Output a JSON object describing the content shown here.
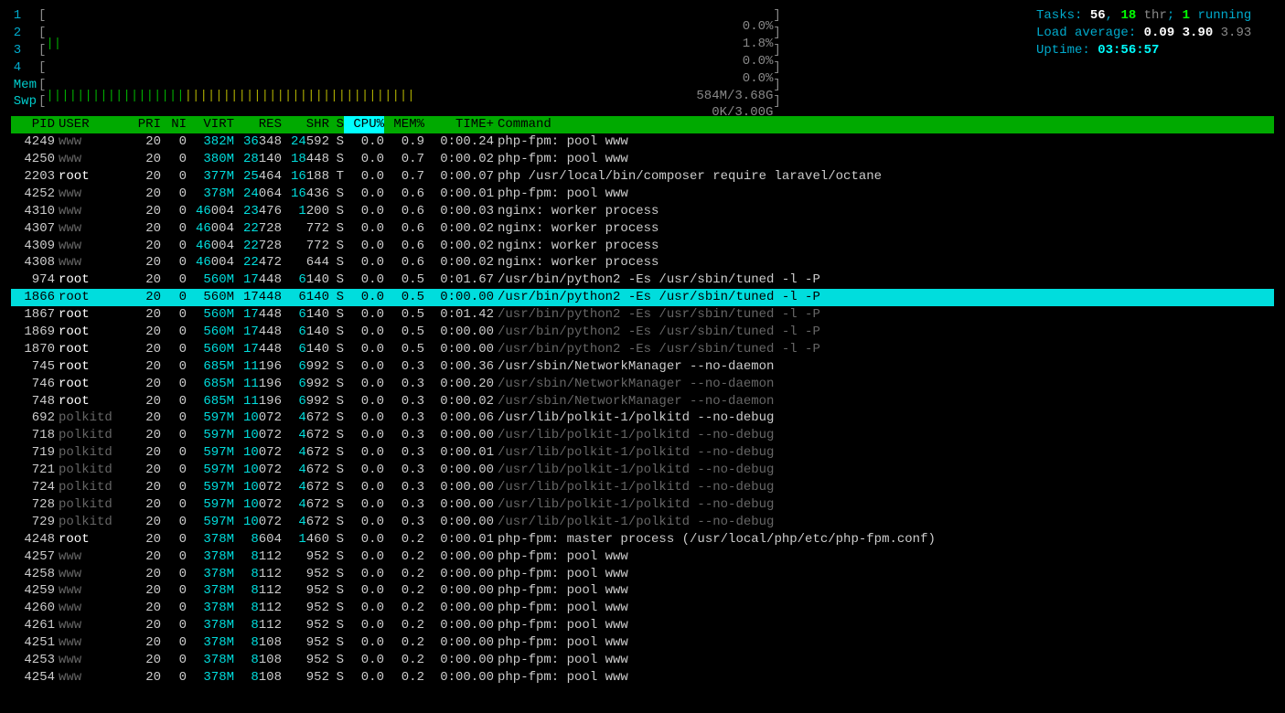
{
  "meters": {
    "cpus": [
      {
        "label": "1",
        "bar": "",
        "pct": "0.0%"
      },
      {
        "label": "2",
        "bar": "||",
        "pct": "1.8%"
      },
      {
        "label": "3",
        "bar": "",
        "pct": "0.0%"
      },
      {
        "label": "4",
        "bar": "",
        "pct": "0.0%"
      }
    ],
    "mem": {
      "label": "Mem",
      "bar_green": "||||||||||||||||||",
      "bar_yellow": "||||||||||||||||||||||||||||||",
      "pct": "584M/3.68G"
    },
    "swp": {
      "label": "Swp",
      "bar": "",
      "pct": "0K/3.00G"
    }
  },
  "stats": {
    "tasks_label": "Tasks: ",
    "tasks_total": "56",
    "tasks_sep": ", ",
    "tasks_thr": "18",
    "tasks_thr_label": " thr",
    "tasks_sep2": "; ",
    "tasks_running": "1",
    "tasks_running_label": " running",
    "load_label": "Load average: ",
    "load1": "0.09",
    "load5": "3.90",
    "load15": "3.93",
    "uptime_label": "Uptime: ",
    "uptime": "03:56:57"
  },
  "headers": {
    "pid": "PID",
    "user": "USER",
    "pri": "PRI",
    "ni": "NI",
    "virt": "VIRT",
    "res": "RES",
    "shr": "SHR",
    "s": "S",
    "cpu": "CPU%",
    "mem": "MEM%",
    "time": "TIME+",
    "cmd": "Command"
  },
  "processes": [
    {
      "pid": "4249",
      "user": "www",
      "udim": true,
      "pri": "20",
      "ni": "0",
      "virt": "382M",
      "res": "36348",
      "resc": 2,
      "shr": "24592",
      "shrc": 2,
      "s": "S",
      "cpu": "0.0",
      "mem": "0.9",
      "time": "0:00.24",
      "cmd": "php-fpm: pool www",
      "cdim": false
    },
    {
      "pid": "4250",
      "user": "www",
      "udim": true,
      "pri": "20",
      "ni": "0",
      "virt": "380M",
      "res": "28140",
      "resc": 2,
      "shr": "18448",
      "shrc": 2,
      "s": "S",
      "cpu": "0.0",
      "mem": "0.7",
      "time": "0:00.02",
      "cmd": "php-fpm: pool www",
      "cdim": false
    },
    {
      "pid": "2203",
      "user": "root",
      "udim": false,
      "pri": "20",
      "ni": "0",
      "virt": "377M",
      "res": "25464",
      "resc": 2,
      "shr": "16188",
      "shrc": 2,
      "s": "T",
      "cpu": "0.0",
      "mem": "0.7",
      "time": "0:00.07",
      "cmd": "php /usr/local/bin/composer require laravel/octane",
      "cdim": false
    },
    {
      "pid": "4252",
      "user": "www",
      "udim": true,
      "pri": "20",
      "ni": "0",
      "virt": "378M",
      "res": "24064",
      "resc": 2,
      "shr": "16436",
      "shrc": 2,
      "s": "S",
      "cpu": "0.0",
      "mem": "0.6",
      "time": "0:00.01",
      "cmd": "php-fpm: pool www",
      "cdim": false
    },
    {
      "pid": "4310",
      "user": "www",
      "udim": true,
      "pri": "20",
      "ni": "0",
      "virt": "46004",
      "res": "23476",
      "resc": 2,
      "shr": "1200",
      "shrc": 1,
      "s": "S",
      "cpu": "0.0",
      "mem": "0.6",
      "time": "0:00.03",
      "cmd": "nginx: worker process",
      "cdim": false
    },
    {
      "pid": "4307",
      "user": "www",
      "udim": true,
      "pri": "20",
      "ni": "0",
      "virt": "46004",
      "res": "22728",
      "resc": 2,
      "shr": "772",
      "shrc": 0,
      "s": "S",
      "cpu": "0.0",
      "mem": "0.6",
      "time": "0:00.02",
      "cmd": "nginx: worker process",
      "cdim": false
    },
    {
      "pid": "4309",
      "user": "www",
      "udim": true,
      "pri": "20",
      "ni": "0",
      "virt": "46004",
      "res": "22728",
      "resc": 2,
      "shr": "772",
      "shrc": 0,
      "s": "S",
      "cpu": "0.0",
      "mem": "0.6",
      "time": "0:00.02",
      "cmd": "nginx: worker process",
      "cdim": false
    },
    {
      "pid": "4308",
      "user": "www",
      "udim": true,
      "pri": "20",
      "ni": "0",
      "virt": "46004",
      "res": "22472",
      "resc": 2,
      "shr": "644",
      "shrc": 0,
      "s": "S",
      "cpu": "0.0",
      "mem": "0.6",
      "time": "0:00.02",
      "cmd": "nginx: worker process",
      "cdim": false
    },
    {
      "pid": "974",
      "user": "root",
      "udim": false,
      "pri": "20",
      "ni": "0",
      "virt": "560M",
      "res": "17448",
      "resc": 2,
      "shr": "6140",
      "shrc": 1,
      "s": "S",
      "cpu": "0.0",
      "mem": "0.5",
      "time": "0:01.67",
      "cmd": "/usr/bin/python2 -Es /usr/sbin/tuned -l -P",
      "cdim": false
    },
    {
      "pid": "1866",
      "user": "root",
      "udim": false,
      "pri": "20",
      "ni": "0",
      "virt": "560M",
      "res": "17448",
      "resc": 2,
      "shr": "6140",
      "shrc": 1,
      "s": "S",
      "cpu": "0.0",
      "mem": "0.5",
      "time": "0:00.00",
      "cmd": "/usr/bin/python2 -Es /usr/sbin/tuned -l -P",
      "cdim": false,
      "sel": true
    },
    {
      "pid": "1867",
      "user": "root",
      "udim": false,
      "pri": "20",
      "ni": "0",
      "virt": "560M",
      "res": "17448",
      "resc": 2,
      "shr": "6140",
      "shrc": 1,
      "s": "S",
      "cpu": "0.0",
      "mem": "0.5",
      "time": "0:01.42",
      "cmd": "/usr/bin/python2 -Es /usr/sbin/tuned -l -P",
      "cdim": true
    },
    {
      "pid": "1869",
      "user": "root",
      "udim": false,
      "pri": "20",
      "ni": "0",
      "virt": "560M",
      "res": "17448",
      "resc": 2,
      "shr": "6140",
      "shrc": 1,
      "s": "S",
      "cpu": "0.0",
      "mem": "0.5",
      "time": "0:00.00",
      "cmd": "/usr/bin/python2 -Es /usr/sbin/tuned -l -P",
      "cdim": true
    },
    {
      "pid": "1870",
      "user": "root",
      "udim": false,
      "pri": "20",
      "ni": "0",
      "virt": "560M",
      "res": "17448",
      "resc": 2,
      "shr": "6140",
      "shrc": 1,
      "s": "S",
      "cpu": "0.0",
      "mem": "0.5",
      "time": "0:00.00",
      "cmd": "/usr/bin/python2 -Es /usr/sbin/tuned -l -P",
      "cdim": true
    },
    {
      "pid": "745",
      "user": "root",
      "udim": false,
      "pri": "20",
      "ni": "0",
      "virt": "685M",
      "res": "11196",
      "resc": 2,
      "shr": "6992",
      "shrc": 1,
      "s": "S",
      "cpu": "0.0",
      "mem": "0.3",
      "time": "0:00.36",
      "cmd": "/usr/sbin/NetworkManager --no-daemon",
      "cdim": false
    },
    {
      "pid": "746",
      "user": "root",
      "udim": false,
      "pri": "20",
      "ni": "0",
      "virt": "685M",
      "res": "11196",
      "resc": 2,
      "shr": "6992",
      "shrc": 1,
      "s": "S",
      "cpu": "0.0",
      "mem": "0.3",
      "time": "0:00.20",
      "cmd": "/usr/sbin/NetworkManager --no-daemon",
      "cdim": true
    },
    {
      "pid": "748",
      "user": "root",
      "udim": false,
      "pri": "20",
      "ni": "0",
      "virt": "685M",
      "res": "11196",
      "resc": 2,
      "shr": "6992",
      "shrc": 1,
      "s": "S",
      "cpu": "0.0",
      "mem": "0.3",
      "time": "0:00.02",
      "cmd": "/usr/sbin/NetworkManager --no-daemon",
      "cdim": true
    },
    {
      "pid": "692",
      "user": "polkitd",
      "udim": true,
      "pri": "20",
      "ni": "0",
      "virt": "597M",
      "res": "10072",
      "resc": 2,
      "shr": "4672",
      "shrc": 1,
      "s": "S",
      "cpu": "0.0",
      "mem": "0.3",
      "time": "0:00.06",
      "cmd": "/usr/lib/polkit-1/polkitd --no-debug",
      "cdim": false
    },
    {
      "pid": "718",
      "user": "polkitd",
      "udim": true,
      "pri": "20",
      "ni": "0",
      "virt": "597M",
      "res": "10072",
      "resc": 2,
      "shr": "4672",
      "shrc": 1,
      "s": "S",
      "cpu": "0.0",
      "mem": "0.3",
      "time": "0:00.00",
      "cmd": "/usr/lib/polkit-1/polkitd --no-debug",
      "cdim": true
    },
    {
      "pid": "719",
      "user": "polkitd",
      "udim": true,
      "pri": "20",
      "ni": "0",
      "virt": "597M",
      "res": "10072",
      "resc": 2,
      "shr": "4672",
      "shrc": 1,
      "s": "S",
      "cpu": "0.0",
      "mem": "0.3",
      "time": "0:00.01",
      "cmd": "/usr/lib/polkit-1/polkitd --no-debug",
      "cdim": true
    },
    {
      "pid": "721",
      "user": "polkitd",
      "udim": true,
      "pri": "20",
      "ni": "0",
      "virt": "597M",
      "res": "10072",
      "resc": 2,
      "shr": "4672",
      "shrc": 1,
      "s": "S",
      "cpu": "0.0",
      "mem": "0.3",
      "time": "0:00.00",
      "cmd": "/usr/lib/polkit-1/polkitd --no-debug",
      "cdim": true
    },
    {
      "pid": "724",
      "user": "polkitd",
      "udim": true,
      "pri": "20",
      "ni": "0",
      "virt": "597M",
      "res": "10072",
      "resc": 2,
      "shr": "4672",
      "shrc": 1,
      "s": "S",
      "cpu": "0.0",
      "mem": "0.3",
      "time": "0:00.00",
      "cmd": "/usr/lib/polkit-1/polkitd --no-debug",
      "cdim": true
    },
    {
      "pid": "728",
      "user": "polkitd",
      "udim": true,
      "pri": "20",
      "ni": "0",
      "virt": "597M",
      "res": "10072",
      "resc": 2,
      "shr": "4672",
      "shrc": 1,
      "s": "S",
      "cpu": "0.0",
      "mem": "0.3",
      "time": "0:00.00",
      "cmd": "/usr/lib/polkit-1/polkitd --no-debug",
      "cdim": true
    },
    {
      "pid": "729",
      "user": "polkitd",
      "udim": true,
      "pri": "20",
      "ni": "0",
      "virt": "597M",
      "res": "10072",
      "resc": 2,
      "shr": "4672",
      "shrc": 1,
      "s": "S",
      "cpu": "0.0",
      "mem": "0.3",
      "time": "0:00.00",
      "cmd": "/usr/lib/polkit-1/polkitd --no-debug",
      "cdim": true
    },
    {
      "pid": "4248",
      "user": "root",
      "udim": false,
      "pri": "20",
      "ni": "0",
      "virt": "378M",
      "res": "8604",
      "resc": 1,
      "shr": "1460",
      "shrc": 1,
      "s": "S",
      "cpu": "0.0",
      "mem": "0.2",
      "time": "0:00.01",
      "cmd": "php-fpm: master process (/usr/local/php/etc/php-fpm.conf)",
      "cdim": false
    },
    {
      "pid": "4257",
      "user": "www",
      "udim": true,
      "pri": "20",
      "ni": "0",
      "virt": "378M",
      "res": "8112",
      "resc": 1,
      "shr": "952",
      "shrc": 0,
      "s": "S",
      "cpu": "0.0",
      "mem": "0.2",
      "time": "0:00.00",
      "cmd": "php-fpm: pool www",
      "cdim": false
    },
    {
      "pid": "4258",
      "user": "www",
      "udim": true,
      "pri": "20",
      "ni": "0",
      "virt": "378M",
      "res": "8112",
      "resc": 1,
      "shr": "952",
      "shrc": 0,
      "s": "S",
      "cpu": "0.0",
      "mem": "0.2",
      "time": "0:00.00",
      "cmd": "php-fpm: pool www",
      "cdim": false
    },
    {
      "pid": "4259",
      "user": "www",
      "udim": true,
      "pri": "20",
      "ni": "0",
      "virt": "378M",
      "res": "8112",
      "resc": 1,
      "shr": "952",
      "shrc": 0,
      "s": "S",
      "cpu": "0.0",
      "mem": "0.2",
      "time": "0:00.00",
      "cmd": "php-fpm: pool www",
      "cdim": false
    },
    {
      "pid": "4260",
      "user": "www",
      "udim": true,
      "pri": "20",
      "ni": "0",
      "virt": "378M",
      "res": "8112",
      "resc": 1,
      "shr": "952",
      "shrc": 0,
      "s": "S",
      "cpu": "0.0",
      "mem": "0.2",
      "time": "0:00.00",
      "cmd": "php-fpm: pool www",
      "cdim": false
    },
    {
      "pid": "4261",
      "user": "www",
      "udim": true,
      "pri": "20",
      "ni": "0",
      "virt": "378M",
      "res": "8112",
      "resc": 1,
      "shr": "952",
      "shrc": 0,
      "s": "S",
      "cpu": "0.0",
      "mem": "0.2",
      "time": "0:00.00",
      "cmd": "php-fpm: pool www",
      "cdim": false
    },
    {
      "pid": "4251",
      "user": "www",
      "udim": true,
      "pri": "20",
      "ni": "0",
      "virt": "378M",
      "res": "8108",
      "resc": 1,
      "shr": "952",
      "shrc": 0,
      "s": "S",
      "cpu": "0.0",
      "mem": "0.2",
      "time": "0:00.00",
      "cmd": "php-fpm: pool www",
      "cdim": false
    },
    {
      "pid": "4253",
      "user": "www",
      "udim": true,
      "pri": "20",
      "ni": "0",
      "virt": "378M",
      "res": "8108",
      "resc": 1,
      "shr": "952",
      "shrc": 0,
      "s": "S",
      "cpu": "0.0",
      "mem": "0.2",
      "time": "0:00.00",
      "cmd": "php-fpm: pool www",
      "cdim": false
    },
    {
      "pid": "4254",
      "user": "www",
      "udim": true,
      "pri": "20",
      "ni": "0",
      "virt": "378M",
      "res": "8108",
      "resc": 1,
      "shr": "952",
      "shrc": 0,
      "s": "S",
      "cpu": "0.0",
      "mem": "0.2",
      "time": "0:00.00",
      "cmd": "php-fpm: pool www",
      "cdim": false
    }
  ]
}
